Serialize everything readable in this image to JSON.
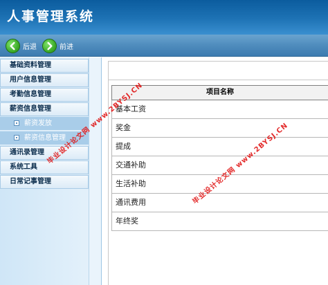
{
  "app": {
    "title": "人事管理系统"
  },
  "toolbar": {
    "back_label": "后退",
    "forward_label": "前进"
  },
  "sidebar": {
    "items": [
      {
        "label": "基础资料管理"
      },
      {
        "label": "用户信息管理"
      },
      {
        "label": "考勤信息管理"
      },
      {
        "label": "薪资信息管理"
      },
      {
        "label": "薪资发放"
      },
      {
        "label": "薪资信息管理"
      },
      {
        "label": "通讯录管理"
      },
      {
        "label": "系统工具"
      },
      {
        "label": "日常记事管理"
      }
    ]
  },
  "table": {
    "header": "项目名称",
    "rows": [
      "基本工资",
      "奖金",
      "提成",
      "交通补助",
      "生活补助",
      "通讯费用",
      "年终奖"
    ]
  },
  "watermarks": {
    "w1": "毕业设计论文网 www.2BYSJ.CN",
    "w2": "毕业设计论文网 www.2BYSJ.CN"
  },
  "colors": {
    "header_bg": "#1e73b5",
    "toolbar_bg": "#4f8cbd",
    "nav_icon": "#3fae2a",
    "watermark": "#e01515"
  }
}
